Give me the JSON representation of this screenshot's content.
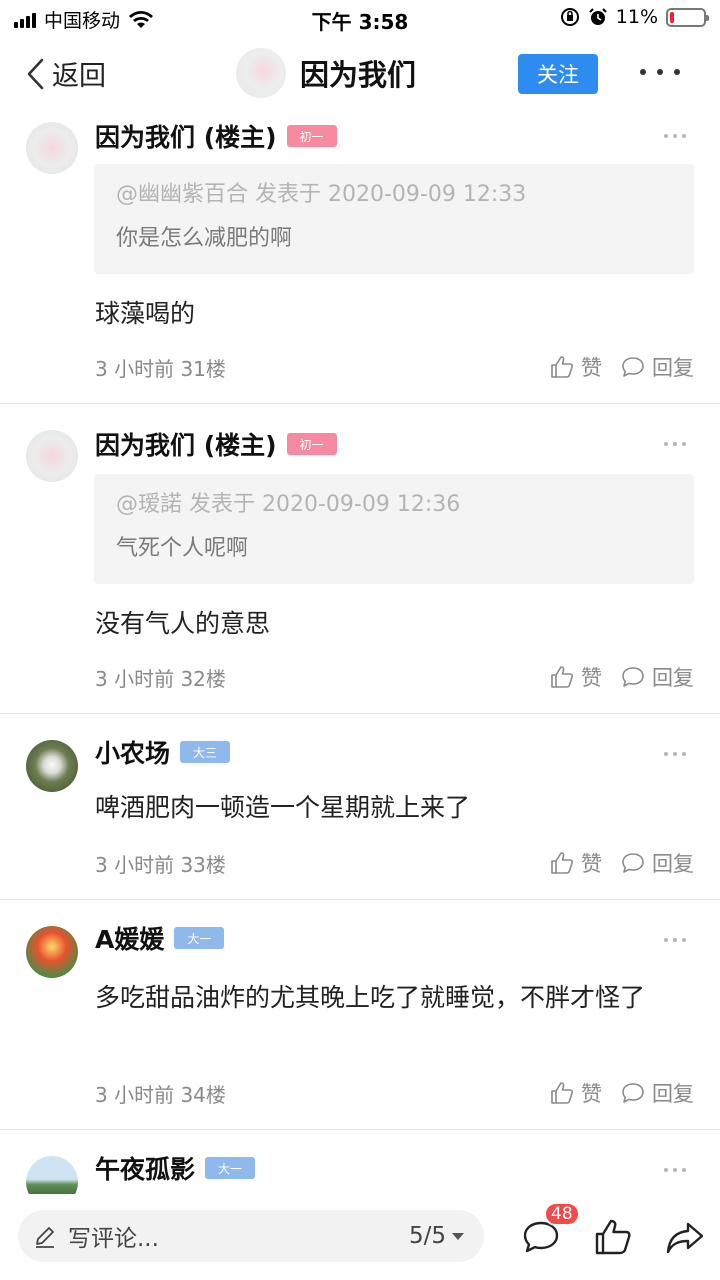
{
  "status_bar": {
    "carrier": "中国移动",
    "time": "下午 3:58",
    "battery": "11%",
    "battery_level": 0.11
  },
  "nav": {
    "back_label": "返回",
    "title": "因为我们",
    "follow_label": "关注"
  },
  "posts": [
    {
      "name": "因为我们 (楼主)",
      "badge": "初一",
      "quote_meta": "@幽幽紫百合 发表于 2020-09-09 12:33",
      "quote_text": "你是怎么减肥的啊",
      "body": "球藻喝的",
      "meta": "3 小时前  31楼",
      "like_label": "赞",
      "reply_label": "回复"
    },
    {
      "name": "因为我们 (楼主)",
      "badge": "初一",
      "quote_meta": "@瑷諾 发表于 2020-09-09 12:36",
      "quote_text": "气死个人呢啊",
      "body": "没有气人的意思",
      "meta": "3 小时前  32楼",
      "like_label": "赞",
      "reply_label": "回复"
    },
    {
      "name": "小农场",
      "badge": "大三",
      "body": "啤酒肥肉一顿造一个星期就上来了",
      "meta": "3 小时前  33楼",
      "like_label": "赞",
      "reply_label": "回复"
    },
    {
      "name": "A媛媛",
      "badge": "大一",
      "body": "多吃甜品油炸的尤其晚上吃了就睡觉，不胖才怪了",
      "meta": "3 小时前  34楼",
      "like_label": "赞",
      "reply_label": "回复"
    },
    {
      "name": "午夜孤影",
      "badge": "大一"
    }
  ],
  "bottom_bar": {
    "comment_placeholder": "写评论...",
    "page": "5/5",
    "comment_count": "48"
  }
}
